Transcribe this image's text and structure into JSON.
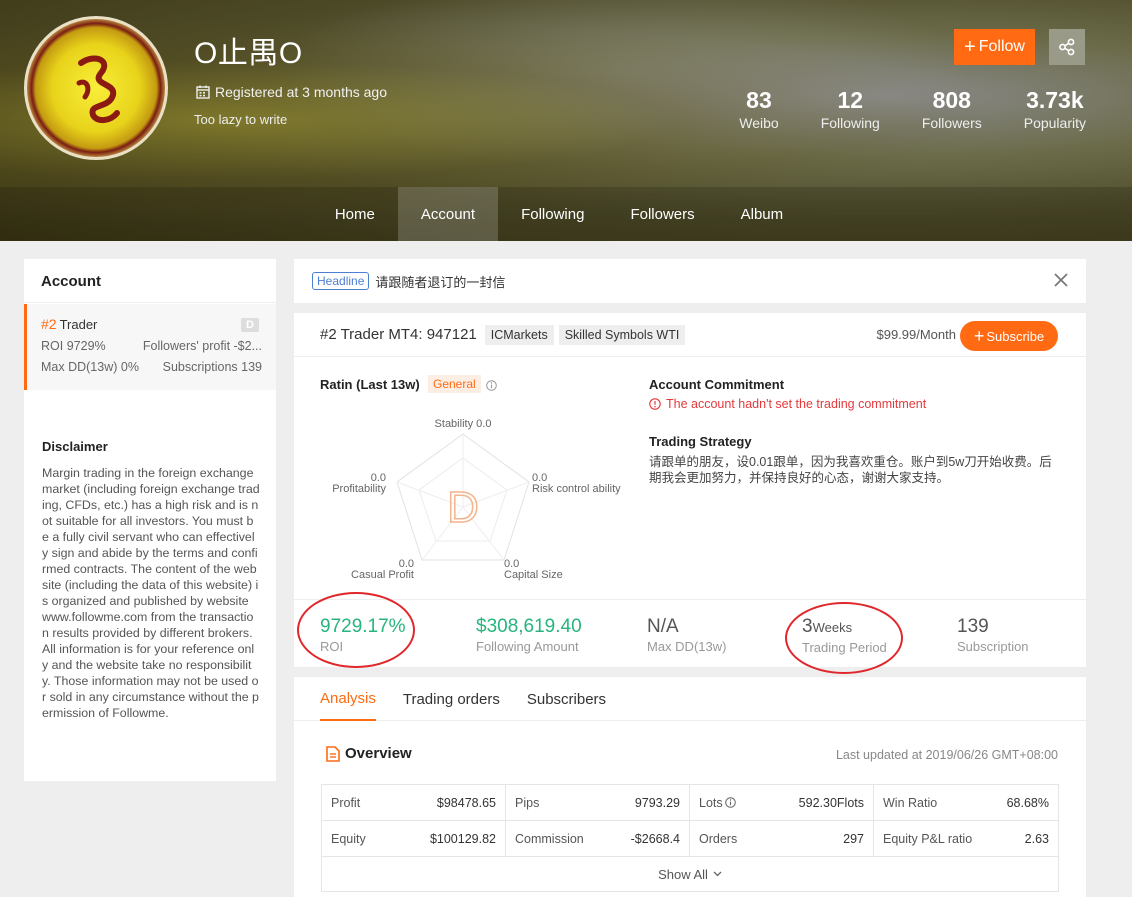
{
  "profile": {
    "name": "O止禺O",
    "registered": "Registered at 3 months ago",
    "bio": "Too lazy to write",
    "follow_label": "Follow",
    "stats": [
      {
        "value": "83",
        "label": "Weibo"
      },
      {
        "value": "12",
        "label": "Following"
      },
      {
        "value": "808",
        "label": "Followers"
      },
      {
        "value": "3.73k",
        "label": "Popularity"
      }
    ]
  },
  "nav": {
    "items": [
      "Home",
      "Account",
      "Following",
      "Followers",
      "Album"
    ],
    "active": "Account"
  },
  "sidebar": {
    "title": "Account",
    "trader": {
      "rank": "#2",
      "label": "Trader",
      "badge": "D",
      "roi_label": "ROI",
      "roi_value": "9729%",
      "followers_profit": "Followers' profit -$2...",
      "maxdd_label": "Max DD(13w)",
      "maxdd_value": "0%",
      "subs_label": "Subscriptions",
      "subs_value": "139"
    },
    "disclaimer_title": "Disclaimer",
    "disclaimer_text": "Margin trading in the foreign exchange market (including foreign exchange trading, CFDs, etc.) has a high risk and is not suitable for all investors. You must be a fully civil servant who can effectively sign and abide by the terms and confirmed contracts. The content of the website (including the data of this website) is organized and published by website www.followme.com from the transaction results provided by different brokers. All information is for your reference only and the website take no responsibility. Those information may not be used or sold in any circumstance without the permission of Followme."
  },
  "headline": {
    "tag": "Headline",
    "text": "请跟随者退订的一封信"
  },
  "trader_panel": {
    "title": "#2 Trader MT4: 947121",
    "chips": [
      "ICMarkets",
      "Skilled Symbols WTI"
    ],
    "price": "$99.99/Month",
    "subscribe_label": "Subscribe",
    "ratin_title": "Ratin (Last 13w)",
    "ratin_tag": "General",
    "radar": {
      "grade": "D",
      "axes": [
        {
          "name": "Stability",
          "value": "0.0"
        },
        {
          "name": "Risk control ability",
          "value": "0.0"
        },
        {
          "name": "Capital Size",
          "value": "0.0"
        },
        {
          "name": "Casual Profit",
          "value": "0.0"
        },
        {
          "name": "Profitability",
          "value": "0.0"
        }
      ]
    },
    "commitment_title": "Account Commitment",
    "commitment_warning": "The account hadn't set the trading commitment",
    "strategy_title": "Trading Strategy",
    "strategy_text": "请跟单的朋友，设0.01跟单，因为我喜欢重仓。账户到5w刀开始收费。后期我会更加努力，并保持良好的心态，谢谢大家支持。",
    "metrics": [
      {
        "value": "9729.17%",
        "label": "ROI",
        "color": "#27b57d"
      },
      {
        "value": "$308,619.40",
        "label": "Following Amount",
        "color": "#27b57d"
      },
      {
        "value": "N/A",
        "label": "Max DD(13w)"
      },
      {
        "value": "3",
        "unit": "Weeks",
        "label": "Trading Period"
      },
      {
        "value": "139",
        "label": "Subscription"
      }
    ]
  },
  "analysis": {
    "tabs": [
      "Analysis",
      "Trading orders",
      "Subscribers"
    ],
    "active_tab": "Analysis",
    "overview_title": "Overview",
    "updated": "Last updated at 2019/06/26 GMT+08:00",
    "rows": [
      [
        [
          "Profit",
          "$98478.65"
        ],
        [
          "Pips",
          "9793.29"
        ],
        [
          "Lots",
          "592.30Flots"
        ],
        [
          "Win Ratio",
          "68.68%"
        ]
      ],
      [
        [
          "Equity",
          "$100129.82"
        ],
        [
          "Commission",
          "-$2668.4"
        ],
        [
          "Orders",
          "297"
        ],
        [
          "Equity P&L ratio",
          "2.63"
        ]
      ]
    ],
    "show_all": "Show All"
  },
  "colors": {
    "accent": "#ff6a13",
    "positive": "#27b57d",
    "warning": "#e4393c",
    "link": "#4d7fd1",
    "highlight_circle": "#e0272b"
  }
}
